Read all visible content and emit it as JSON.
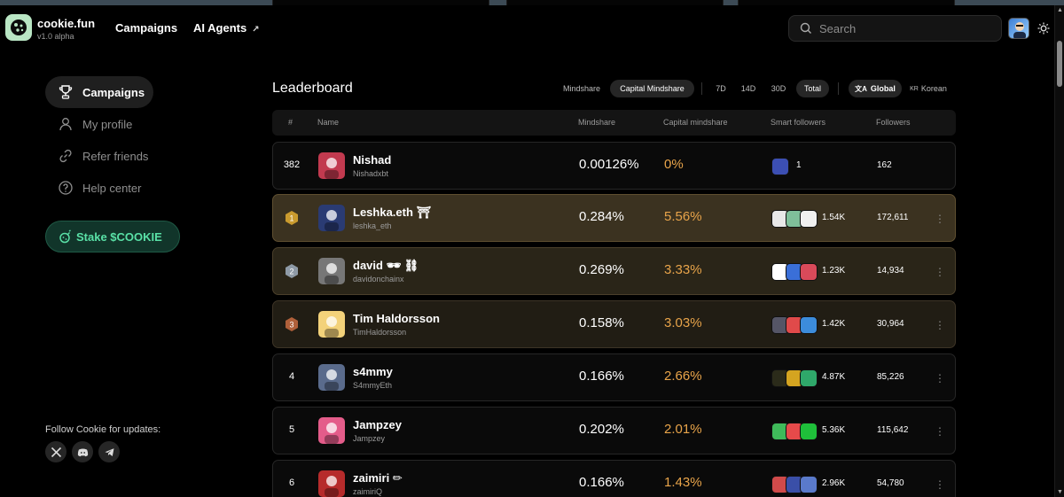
{
  "header": {
    "brand_name": "cookie.fun",
    "brand_version": "v1.0 alpha",
    "nav_campaigns": "Campaigns",
    "nav_ai_agents": "AI Agents",
    "search_placeholder": "Search"
  },
  "sidebar": {
    "items": [
      {
        "label": "Campaigns",
        "icon": "trophy-icon",
        "active": true
      },
      {
        "label": "My profile",
        "icon": "user-icon",
        "active": false
      },
      {
        "label": "Refer friends",
        "icon": "link-icon",
        "active": false
      },
      {
        "label": "Help center",
        "icon": "help-icon",
        "active": false
      }
    ],
    "stake_label": "Stake $COOKIE",
    "follow_label": "Follow Cookie for updates:",
    "socials": [
      "x-icon",
      "discord-icon",
      "telegram-icon"
    ]
  },
  "leaderboard": {
    "title": "Leaderboard",
    "metric_tabs": [
      "Mindshare",
      "Capital Mindshare"
    ],
    "active_metric": "Capital Mindshare",
    "time_tabs": [
      "7D",
      "14D",
      "30D",
      "Total"
    ],
    "active_time": "Total",
    "region_tabs": [
      "Global",
      "Korean"
    ],
    "active_region": "Global",
    "region_prefix_korean": "KR",
    "columns": [
      "#",
      "Name",
      "Mindshare",
      "Capital mindshare",
      "Smart followers",
      "Followers"
    ],
    "rows": [
      {
        "rank": "382",
        "name": "Nishad",
        "handle": "Nishadxbt",
        "mindshare": "0.00126%",
        "capital_mindshare": "0%",
        "smart_followers": "1",
        "followers": "162",
        "style": "plain",
        "medal": ""
      },
      {
        "rank": "1",
        "name": "Leshka.eth ⛩",
        "handle": "leshka_eth",
        "mindshare": "0.284%",
        "capital_mindshare": "5.56%",
        "smart_followers": "1.54K",
        "followers": "172,611",
        "style": "gold",
        "medal": "gold"
      },
      {
        "rank": "2",
        "name": "david 🕶 ⛓",
        "handle": "davidonchainx",
        "mindshare": "0.269%",
        "capital_mindshare": "3.33%",
        "smart_followers": "1.23K",
        "followers": "14,934",
        "style": "brown",
        "medal": "silver"
      },
      {
        "rank": "3",
        "name": "Tim Haldorsson",
        "handle": "TimHaldorsson",
        "mindshare": "0.158%",
        "capital_mindshare": "3.03%",
        "smart_followers": "1.42K",
        "followers": "30,964",
        "style": "bronze",
        "medal": "bronze"
      },
      {
        "rank": "4",
        "name": "s4mmy",
        "handle": "S4mmyEth",
        "mindshare": "0.166%",
        "capital_mindshare": "2.66%",
        "smart_followers": "4.87K",
        "followers": "85,226",
        "style": "plain",
        "medal": ""
      },
      {
        "rank": "5",
        "name": "Jampzey",
        "handle": "Jampzey",
        "mindshare": "0.202%",
        "capital_mindshare": "2.01%",
        "smart_followers": "5.36K",
        "followers": "115,642",
        "style": "plain",
        "medal": ""
      },
      {
        "rank": "6",
        "name": "zaimiri ✏",
        "handle": "zaimiriQ",
        "mindshare": "0.166%",
        "capital_mindshare": "1.43%",
        "smart_followers": "2.96K",
        "followers": "54,780",
        "style": "plain",
        "medal": ""
      }
    ]
  },
  "colors": {
    "accent_orange": "#e8a44a",
    "stake_green": "#59e0a6",
    "gold_row": "#3b3220",
    "medal_gold": "#c99a2e",
    "medal_silver": "#8e9aa6",
    "medal_bronze": "#b0603a"
  }
}
